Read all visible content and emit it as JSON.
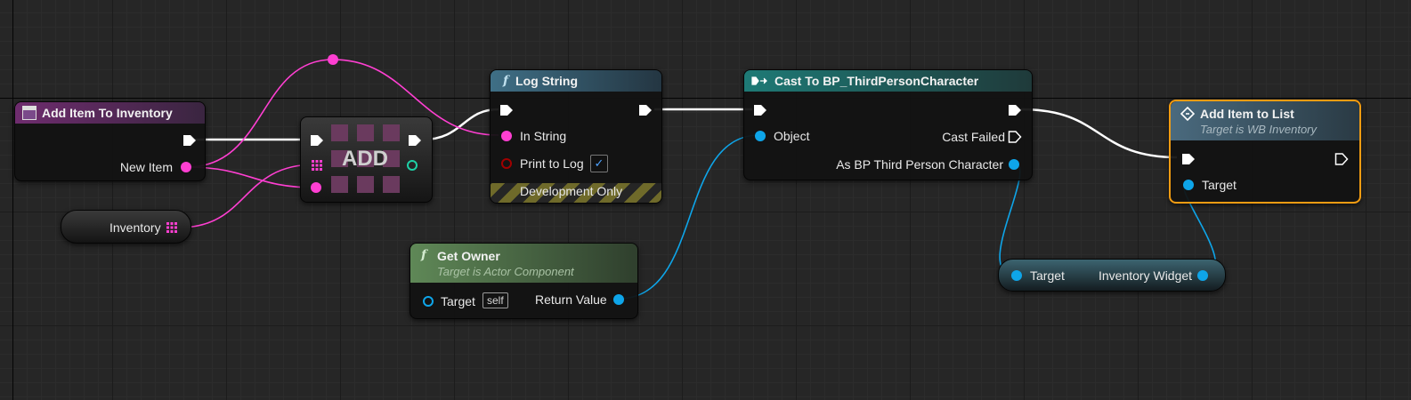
{
  "colors": {
    "exec": "#ffffff",
    "object": "#0ea5e9",
    "structure": "#ff3fd2",
    "boolean": "#a10000",
    "selected_border": "#f39c12"
  },
  "nodes": {
    "add_item_to_inventory": {
      "title": "Add Item To Inventory",
      "pin_new_item": "New Item",
      "icon": "event-icon"
    },
    "inventory_var": {
      "label": "Inventory"
    },
    "add": {
      "label": "ADD"
    },
    "log_string": {
      "title": "Log String",
      "func_glyph": "f",
      "pin_in_string": "In String",
      "pin_print_to_log": "Print to Log",
      "print_to_log_checked": true,
      "check_glyph": "✓",
      "footer": "Development Only"
    },
    "get_owner": {
      "title": "Get Owner",
      "func_glyph": "f",
      "subtitle": "Target is Actor Component",
      "pin_target": "Target",
      "target_default": "self",
      "pin_return": "Return Value"
    },
    "cast": {
      "title": "Cast To BP_ThirdPersonCharacter",
      "pin_object": "Object",
      "pin_cast_failed": "Cast Failed",
      "pin_as": "As BP Third Person Character"
    },
    "inventory_widget_get": {
      "pin_target": "Target",
      "pin_out": "Inventory Widget"
    },
    "add_item_to_list": {
      "title": "Add Item to List",
      "subtitle": "Target is WB Inventory",
      "pin_target": "Target",
      "selected": true
    }
  }
}
